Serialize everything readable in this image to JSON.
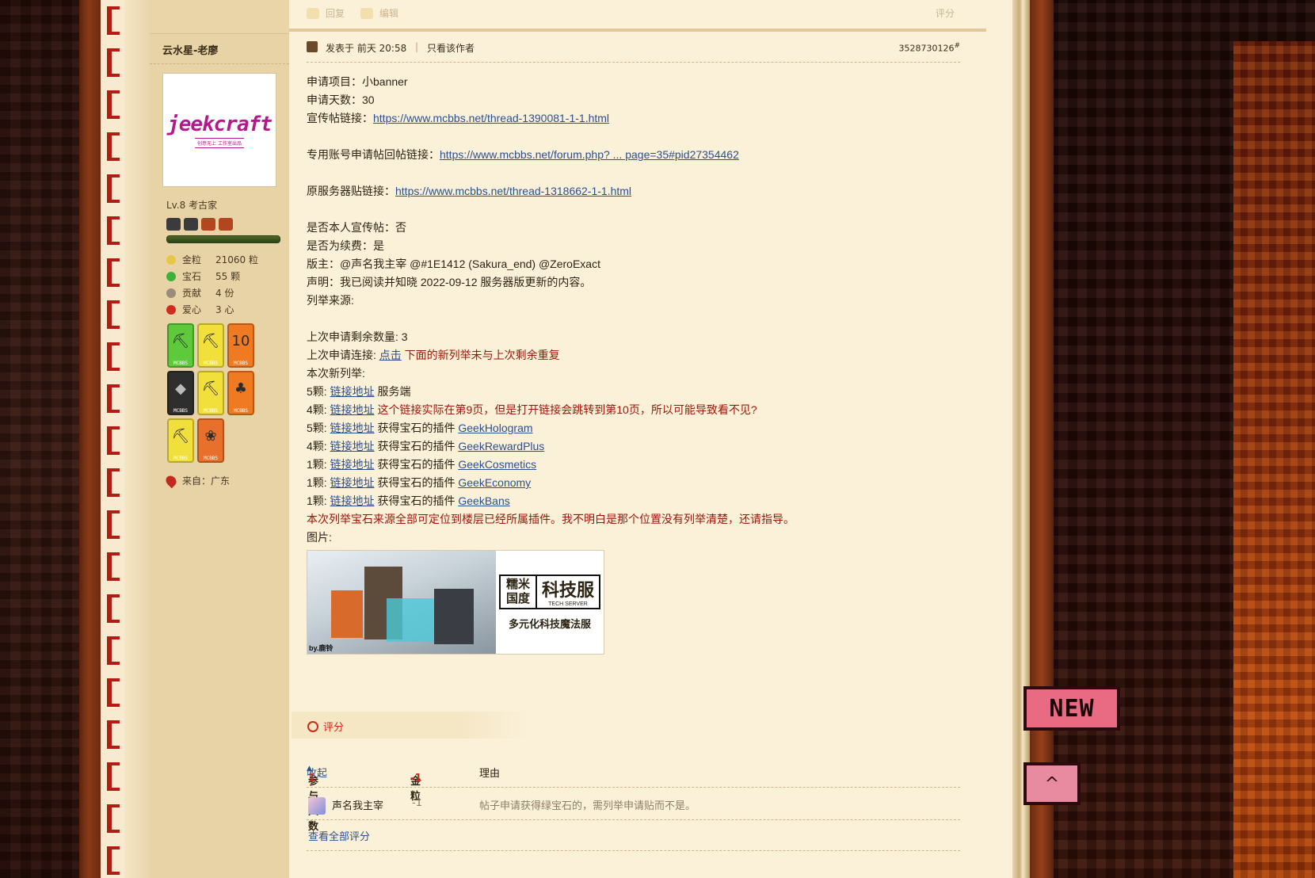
{
  "toolbar": {
    "reply_label": "回复",
    "edit_label": "编辑",
    "rate_label": "评分"
  },
  "author": {
    "name": "云水星-老廖",
    "avatar_logo": "jeekcraft",
    "avatar_sub": "创意无上 工作室出品",
    "level": "Lv.8 考古家",
    "stats": [
      {
        "label": "金粒",
        "value": "21060 粒",
        "color": "#e8c64a"
      },
      {
        "label": "宝石",
        "value": "55 颗",
        "color": "#3fb13a"
      },
      {
        "label": "贡献",
        "value": "4 份",
        "color": "#9a8a7a"
      },
      {
        "label": "爱心",
        "value": "3 心",
        "color": "#d12a1e"
      }
    ],
    "medal_caption": "MCBBS",
    "medal_glyphs": [
      "⛏",
      "⛏",
      "10",
      "◆",
      "⛏",
      "♣",
      "⛏",
      "❀"
    ],
    "from": "来自：广东"
  },
  "post": {
    "posted_at": "发表于 前天 20:58",
    "only_author": "只看该作者",
    "floor": "3528730126",
    "floor_mark": "#",
    "lines": {
      "project": "申请项目：小banner",
      "days": "申请天数：30",
      "promo_label": "宣传帖链接：",
      "promo_link": "https://www.mcbbs.net/thread-1390081-1-1.html",
      "acct_label": "专用账号申请帖回帖链接：",
      "acct_link": "https://www.mcbbs.net/forum.php? ... page=35#pid27354462",
      "orig_label": "原服务器贴链接：",
      "orig_link": "https://www.mcbbs.net/thread-1318662-1-1.html",
      "self_promo": "是否本人宣传帖：否",
      "renew": "是否为续费：是",
      "moderators": "版主：@声名我主宰 @#1E1412 (Sakura_end) @ZeroExact",
      "statement": "声明：我已阅读并知晓 2022-09-12 服务器版更新的内容。",
      "source": "列举来源:",
      "remaining": "上次申请剩余数量: 3",
      "prev_label": "上次申请连接: ",
      "prev_link": "点击",
      "prev_note": " 下面的新列举未与上次剩余重复",
      "new_list": "本次新列举:",
      "final_note": "本次列举宝石来源全部可定位到楼层已经所属插件。我不明白是那个位置没有列举清楚，还请指导。",
      "image_label": "图片:"
    },
    "items": [
      {
        "count": "5颗: ",
        "link": "链接地址",
        "desc": " 服务端",
        "red": false,
        "plugin": ""
      },
      {
        "count": "4颗: ",
        "link": "链接地址",
        "desc": " 这个链接实际在第9页，但是打开链接会跳转到第10页，所以可能导致看不见?",
        "red": true,
        "plugin": ""
      },
      {
        "count": "5颗: ",
        "link": "链接地址",
        "desc": " 获得宝石的插件 ",
        "red": false,
        "plugin": "GeekHologram"
      },
      {
        "count": "4颗: ",
        "link": "链接地址",
        "desc": " 获得宝石的插件 ",
        "red": false,
        "plugin": "GeekRewardPlus"
      },
      {
        "count": "1颗: ",
        "link": "链接地址",
        "desc": " 获得宝石的插件 ",
        "red": false,
        "plugin": "GeekCosmetics"
      },
      {
        "count": "1颗: ",
        "link": "链接地址",
        "desc": " 获得宝石的插件 ",
        "red": false,
        "plugin": "GeekEconomy"
      },
      {
        "count": "1颗: ",
        "link": "链接地址",
        "desc": " 获得宝石的插件 ",
        "red": false,
        "plugin": "GeekBans"
      }
    ],
    "banner": {
      "caption": "by.鹿铃",
      "brand_left": "糯米国度",
      "brand_right": "科技服",
      "brand_sub": "TECH SERVER",
      "slogan": "多元化科技魔法服"
    }
  },
  "rating": {
    "title": "评分",
    "participants_label": "参与人数",
    "participants": "1",
    "gold_label": "金粒",
    "gold": "-1",
    "reason_label": "理由",
    "collapse": "收起",
    "rows": [
      {
        "user": "声名我主宰",
        "gold": "-1",
        "reason": "帖子申请获得绿宝石的，需列举申请贴而不是。"
      }
    ],
    "view_all": "查看全部评分"
  },
  "badges": {
    "new": "NEW",
    "top": "^"
  }
}
